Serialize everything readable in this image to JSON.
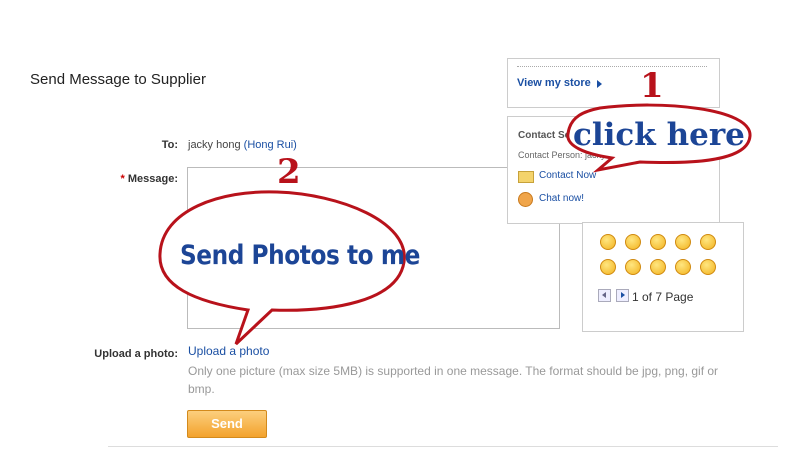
{
  "page": {
    "title": "Send Message to Supplier"
  },
  "form": {
    "to_label": "To:",
    "to_name": "jacky hong",
    "to_company": "(Hong Rui)",
    "message_label": "Message:",
    "required_marker": "*",
    "upload_label": "Upload a photo:",
    "upload_link": "Upload a photo",
    "upload_note": "Only one picture (max size 5MB) is supported in one message. The format should be jpg, png, gif or bmp.",
    "send_label": "Send"
  },
  "sidebar": {
    "store_link": "View my store",
    "contact_title": "Contact Seller",
    "contact_person": "Contact Person: jacky shao",
    "contact_now": "Contact Now",
    "chat_now": "Chat now!"
  },
  "emoji_panel": {
    "pager_text": "1 of 7 Page",
    "emoji_count_shown": 10
  },
  "annotations": {
    "step1_number": "1",
    "step1_text": "click here",
    "step2_number": "2",
    "step2_text": "Send  Photos to me",
    "color": "#b8121b"
  },
  "colors": {
    "link": "#1a4fa3",
    "send_button": "#f3a22c",
    "callout_text": "#1c4596"
  }
}
